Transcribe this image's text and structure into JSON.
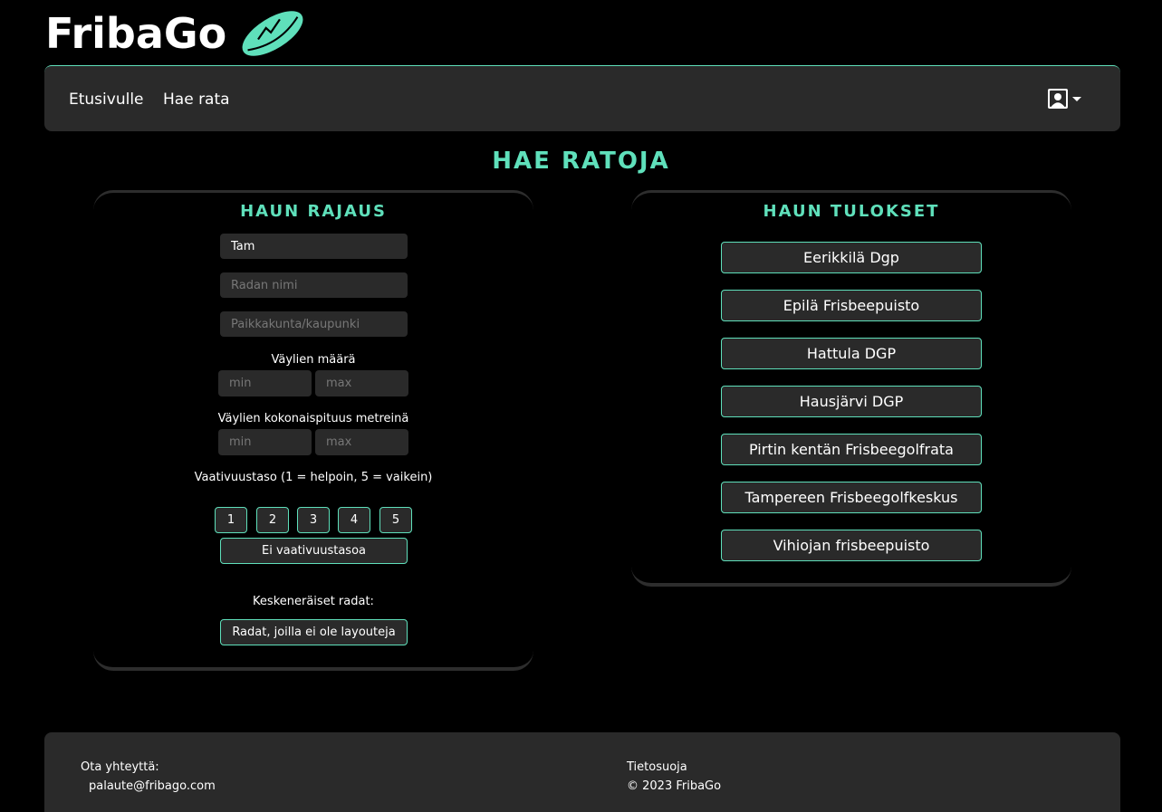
{
  "brand": {
    "name": "FribaGo"
  },
  "nav": {
    "home": "Etusivulle",
    "search": "Hae rata"
  },
  "page_title": "HAE RATOJA",
  "filters": {
    "title": "HAUN RAJAUS",
    "general_search_value": "Tam",
    "course_name_placeholder": "Radan nimi",
    "city_placeholder": "Paikkakunta/kaupunki",
    "holes_label": "Väylien määrä",
    "holes_min_placeholder": "min",
    "holes_max_placeholder": "max",
    "length_label": "Väylien kokonaispituus metreinä",
    "length_min_placeholder": "min",
    "length_max_placeholder": "max",
    "difficulty_label": "Vaativuustaso (1 = helpoin, 5 = vaikein)",
    "difficulty_levels": [
      "1",
      "2",
      "3",
      "4",
      "5"
    ],
    "no_difficulty_button": "Ei vaativuustasoa",
    "incomplete_label": "Keskeneräiset radat:",
    "no_layouts_button": "Radat, joilla ei ole layouteja"
  },
  "results": {
    "title": "HAUN TULOKSET",
    "items": [
      "Eerikkilä Dgp",
      "Epilä Frisbeepuisto",
      "Hattula DGP",
      "Hausjärvi DGP",
      "Pirtin kentän Frisbeegolfrata",
      "Tampereen Frisbeegolfkeskus",
      "Vihiojan frisbeepuisto"
    ]
  },
  "footer": {
    "contact_label": "Ota yhteyttä:",
    "contact_email": "palaute@fribago.com",
    "privacy": "Tietosuoja",
    "copyright": "© 2023 FribaGo"
  },
  "colors": {
    "accent": "#5fe0bb",
    "surface": "#2a2a2a",
    "background": "#000000"
  },
  "icons": {
    "logo": "frisbee-disc-icon",
    "user": "user-profile-icon",
    "dropdown": "caret-down-icon"
  }
}
